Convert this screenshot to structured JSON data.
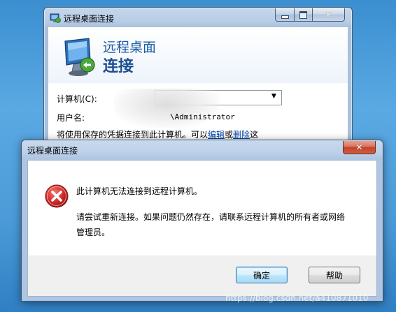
{
  "rdc_window": {
    "title": "远程桌面连接",
    "banner_line1": "远程桌面",
    "banner_line2": "连接",
    "computer_label": "计算机(C):",
    "computer_value": "",
    "username_label": "用户名:",
    "username_value": "\\Administrator",
    "note_prefix": "将使用保存的凭据连接到此计算机。可以",
    "note_edit_link": "编辑",
    "note_or": "或",
    "note_delete_link": "删除",
    "note_suffix": "这",
    "icons": [
      "remote-desktop-app-icon",
      "remote-desktop-banner-icon"
    ]
  },
  "error_dialog": {
    "title": "远程桌面连接",
    "message_main": "此计算机无法连接到远程计算机。",
    "message_detail": "请尝试重新连接。如果问题仍然存在，请联系远程计算机的所有者或网络管理员。",
    "ok_label": "确定",
    "help_label": "帮助",
    "icon": "error-icon"
  },
  "watermark": "https://blog.csdn.net/a410871010",
  "colors": {
    "desktop": "#4c9bd8",
    "link": "#0645ad",
    "error_red": "#d32b2b",
    "banner_text": "#1b5aa6"
  }
}
